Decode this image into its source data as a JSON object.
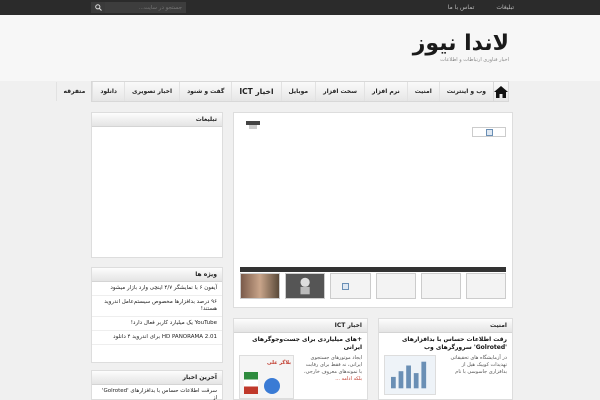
{
  "topbar": {
    "links": [
      "تبلیغات",
      "تماس با ما"
    ],
    "search_placeholder": "جستجو در سایت..."
  },
  "logo": {
    "title": "لاندا نیوز",
    "subtitle": "اخبار فناوری ارتباطات و اطلاعات"
  },
  "nav": {
    "items": [
      "وب و اینترنت",
      "امنیت",
      "نرم افزار",
      "سخت افزار",
      "موبایل",
      "اخبار ICT",
      "گفت و شنود",
      "اخبار تصویری",
      "دانلود",
      "متفرقه"
    ]
  },
  "sidebar": {
    "ads_title": "تبلیغات",
    "special_title": "ویژه ها",
    "special_items": [
      "آیفون ۶ با نمایشگر ۴/۷ اینچی وارد بازار میشود",
      "۹۶ درصد بدافزارها مخصوص سیستم‌عامل اندروید هستند!",
      "YouTube یک میلیارد کاربر فعال دارد!",
      "HD PANORAMA 2.01 برای اندروید ۴ دانلود"
    ],
    "latest_title": "آخرین اخبار",
    "latest_items": [
      "سرقت اطلاعات حساس با بدافزارهای 'Golroted' از"
    ]
  },
  "news": {
    "ict_title": "اخبار ICT",
    "ict_headline": "+های میلیاردی برای جست‌وجوگرهای ایرانی",
    "ict_text": [
      "ایجاد موتورهای جستجوی",
      "ایرانی، نه فقط برای رقابت",
      "با نمونه‌های معروف خارجی،",
      "بلکه ادامه ..."
    ],
    "ict_badge": "بلاگر علی",
    "security_title": "امنیت",
    "security_headline": "رقت اطلاعات حساس با بدافزارهای 'Golroted' سرورگرهای وب",
    "security_text": [
      "در آزمایشگاه های تحقیقاتی",
      "تهدیدات کوییک هیل از",
      "بدافزاری جاسوسی با نام"
    ]
  },
  "colors": {
    "topbar": "#2b2b2b",
    "accent": "#c0392b"
  }
}
